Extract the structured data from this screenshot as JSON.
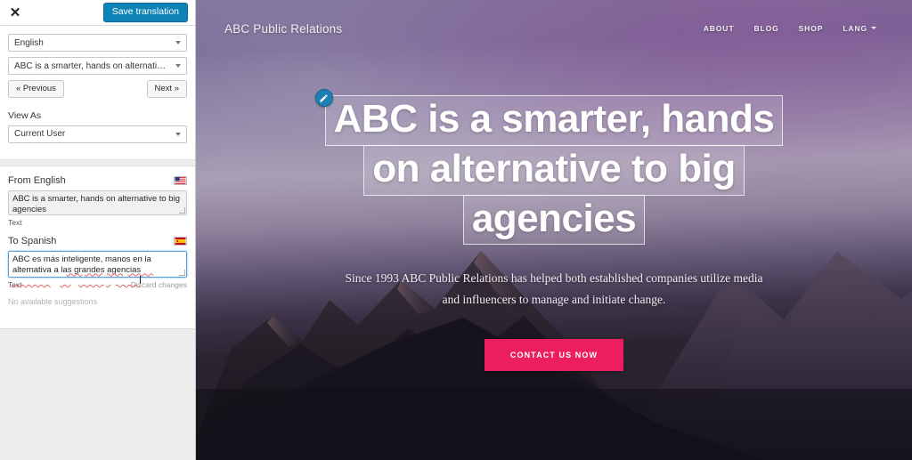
{
  "sidebar": {
    "close_label": "✕",
    "save_button": "Save translation",
    "language_select": "English",
    "string_select": "ABC is a smarter, hands on alternative t...",
    "previous_button": "« Previous",
    "next_button": "Next »",
    "view_as_label": "View As",
    "view_as_value": "Current User",
    "source": {
      "heading": "From English",
      "flag": "us-flag-icon",
      "value": "ABC is a smarter, hands on alternative to big agencies",
      "meta": "Text"
    },
    "target": {
      "heading": "To Spanish",
      "flag": "es-flag-icon",
      "value": "ABC es más inteligente, manos en la alternativa a las grandes agencias",
      "meta": "Text",
      "discard_label": "Discard changes",
      "suggestions": "No available suggestions",
      "spell_errors": [
        "más",
        "inteligente",
        "manos",
        "alternativa",
        "las",
        "grandes",
        "agencias"
      ]
    }
  },
  "site": {
    "brand": "ABC Public Relations",
    "nav": [
      {
        "label": "ABOUT",
        "has_caret": false
      },
      {
        "label": "BLOG",
        "has_caret": false
      },
      {
        "label": "SHOP",
        "has_caret": false
      },
      {
        "label": "LANG",
        "has_caret": true
      }
    ],
    "hero": {
      "edit_icon": "pencil-edit-icon",
      "headline_lines": [
        "ABC is a smarter, hands",
        "on alternative to big",
        "agencies"
      ],
      "subheading": "Since 1993 ABC Public Relations has helped both established companies utilize media and influencers to manage and initiate change.",
      "cta_label": "CONTACT US NOW"
    }
  },
  "colors": {
    "save_button_blue": "#0e83b8",
    "cta_pink": "#ec1e5f",
    "edit_badge_blue": "#1d7fb5",
    "textarea_focus_border": "#5b9dd9",
    "spell_underline": "#e06666",
    "sidebar_bg": "#ffffff",
    "sidebar_footer_bg": "#eeeeee"
  }
}
